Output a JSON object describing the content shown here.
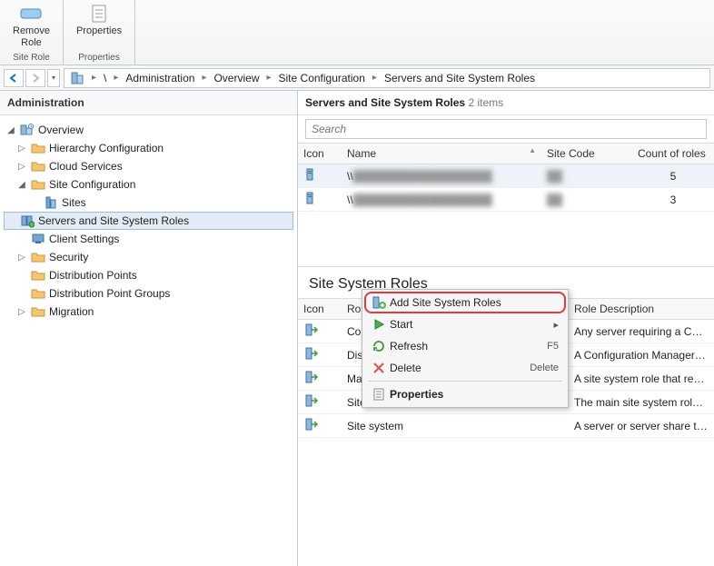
{
  "ribbon": {
    "groups": [
      {
        "label": "Site Role",
        "button": {
          "label": "Remove\nRole",
          "icon": "remove-role"
        }
      },
      {
        "label": "Properties",
        "button": {
          "label": "Properties",
          "icon": "properties"
        }
      }
    ]
  },
  "breadcrumb": {
    "items": [
      "\\",
      "Administration",
      "Overview",
      "Site Configuration",
      "Servers and Site System Roles"
    ]
  },
  "left": {
    "title": "Administration",
    "tree": [
      {
        "label": "Overview",
        "icon": "overview",
        "expanded": true,
        "level": 0
      },
      {
        "label": "Hierarchy Configuration",
        "icon": "folder",
        "level": 1,
        "expandable": true
      },
      {
        "label": "Cloud Services",
        "icon": "folder",
        "level": 1,
        "expandable": true
      },
      {
        "label": "Site Configuration",
        "icon": "folder",
        "level": 1,
        "expanded": true,
        "expandable": true
      },
      {
        "label": "Sites",
        "icon": "sites",
        "level": 2
      },
      {
        "label": "Servers and Site System Roles",
        "icon": "servers",
        "level": 2,
        "selected": true
      },
      {
        "label": "Client Settings",
        "icon": "client-settings",
        "level": 1
      },
      {
        "label": "Security",
        "icon": "folder",
        "level": 1,
        "expandable": true
      },
      {
        "label": "Distribution Points",
        "icon": "folder",
        "level": 1
      },
      {
        "label": "Distribution Point Groups",
        "icon": "folder",
        "level": 1
      },
      {
        "label": "Migration",
        "icon": "folder",
        "level": 1,
        "expandable": true
      }
    ]
  },
  "right": {
    "title": "Servers and Site System Roles",
    "count_label": "2 items",
    "search_placeholder": "Search",
    "servers": {
      "columns": [
        "Icon",
        "Name",
        "Site Code",
        "Count of roles"
      ],
      "sort_indicator_col": 1,
      "rows": [
        {
          "name": "\\\\",
          "site_code": "",
          "count": "5",
          "blurred": true,
          "selected": true
        },
        {
          "name": "\\\\",
          "site_code": "",
          "count": "3",
          "blurred": true
        }
      ]
    },
    "roles_section_title": "Site System Roles",
    "roles": {
      "columns": [
        "Icon",
        "Role Name",
        "Role Description"
      ],
      "sort_indicator_col": 1,
      "rows": [
        {
          "name": "Component server",
          "desc": "Any server requiring a Configurati"
        },
        {
          "name": "Distribution point",
          "desc": "A Configuration Manager server r"
        },
        {
          "name": "Management point",
          "desc": "A site system role that replies to C"
        },
        {
          "name": "Site server",
          "desc": "The main site system role that hos"
        },
        {
          "name": "Site system",
          "desc": "A server or server share that hosts"
        }
      ]
    }
  },
  "context_menu": {
    "items": [
      {
        "label": "Add Site System Roles",
        "icon": "add-roles",
        "highlight": true
      },
      {
        "label": "Start",
        "icon": "start",
        "submenu": true
      },
      {
        "label": "Refresh",
        "icon": "refresh",
        "shortcut": "F5"
      },
      {
        "label": "Delete",
        "icon": "delete",
        "shortcut": "Delete"
      },
      {
        "sep": true
      },
      {
        "label": "Properties",
        "icon": "properties",
        "bold": true
      }
    ]
  }
}
